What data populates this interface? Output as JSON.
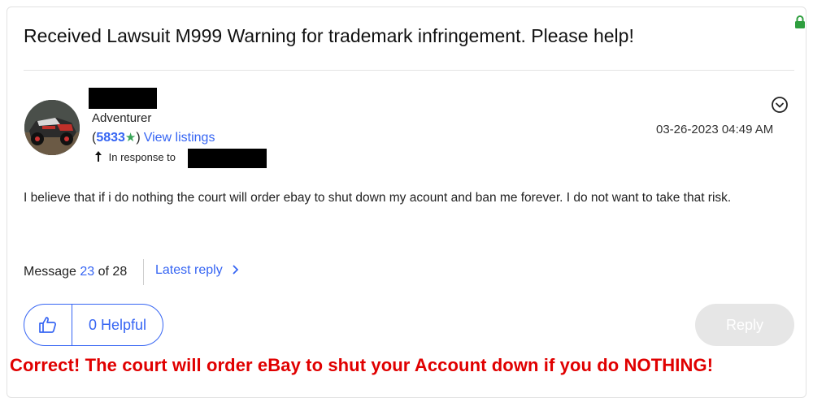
{
  "post": {
    "title": "Received Lawsuit M999 Warning for trademark infringement. Please help!",
    "author": {
      "rank": "Adventurer",
      "feedback_open": "(",
      "feedback_score": "5833",
      "feedback_star": "★",
      "feedback_close": ")",
      "view_listings": "View listings"
    },
    "in_response_to_label": "In response to",
    "timestamp": "03-26-2023 04:49 AM",
    "body": "I believe that if i do nothing the court will order ebay to shut down my acount and ban me forever. I do not want to take that risk.",
    "message_prefix": "Message",
    "message_number": "23",
    "message_of": "of 28",
    "latest_reply": "Latest reply",
    "helpful_label": "0 Helpful",
    "reply_label": "Reply"
  },
  "annotation": "Correct! The court will order eBay to shut your Account down if you do NOTHING!",
  "colors": {
    "link": "#3665f3",
    "star": "#3aa559",
    "annotation": "#e00000",
    "lock": "#2e9e3e"
  },
  "icons": [
    "lock-icon",
    "chevron-circle-down-icon",
    "reply-arrow-icon",
    "thumbs-up-icon",
    "chevron-right-icon"
  ]
}
